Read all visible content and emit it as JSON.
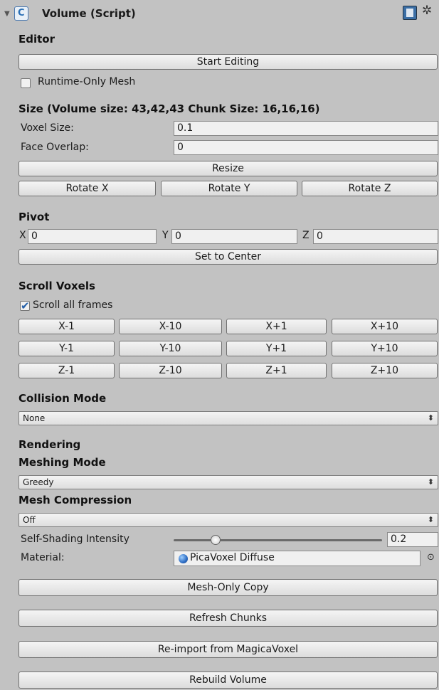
{
  "header": {
    "title": "Volume (Script)"
  },
  "editor": {
    "heading": "Editor",
    "start_editing": "Start Editing",
    "runtime_only_mesh": "Runtime-Only Mesh"
  },
  "size": {
    "heading": "Size (Volume size: 43,42,43 Chunk Size: 16,16,16)",
    "voxel_size_label": "Voxel Size:",
    "voxel_size_value": "0.1",
    "face_overlap_label": "Face Overlap:",
    "face_overlap_value": "0",
    "resize": "Resize",
    "rotate_x": "Rotate X",
    "rotate_y": "Rotate Y",
    "rotate_z": "Rotate Z"
  },
  "pivot": {
    "heading": "Pivot",
    "x_label": "X",
    "x_value": "0",
    "y_label": "Y",
    "y_value": "0",
    "z_label": "Z",
    "z_value": "0",
    "set_to_center": "Set to Center"
  },
  "scroll": {
    "heading": "Scroll Voxels",
    "all_frames": "Scroll all frames",
    "buttons": [
      [
        "X-1",
        "X-10",
        "X+1",
        "X+10"
      ],
      [
        "Y-1",
        "Y-10",
        "Y+1",
        "Y+10"
      ],
      [
        "Z-1",
        "Z-10",
        "Z+1",
        "Z+10"
      ]
    ]
  },
  "collision": {
    "heading": "Collision Mode",
    "value": "None"
  },
  "rendering": {
    "heading": "Rendering",
    "meshing_heading": "Meshing Mode",
    "meshing_value": "Greedy",
    "compression_heading": "Mesh Compression",
    "compression_value": "Off",
    "shading_label": "Self-Shading Intensity",
    "shading_value": "0.2",
    "shading_level": 0.2,
    "material_label": "Material:",
    "material_value": "PicaVoxel Diffuse"
  },
  "actions": {
    "mesh_only_copy": "Mesh-Only Copy",
    "refresh_chunks": "Refresh Chunks",
    "reimport": "Re-import from MagicaVoxel",
    "rebuild": "Rebuild Volume"
  }
}
